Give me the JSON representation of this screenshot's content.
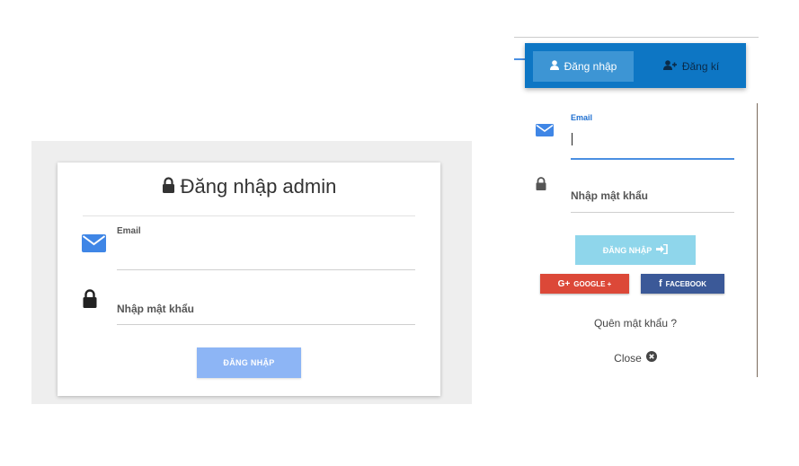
{
  "admin": {
    "title": "Đăng nhập admin",
    "email_label": "Email",
    "email_value": "",
    "password_placeholder": "Nhập mật khẩu",
    "submit_label": "ĐĂNG NHẬP"
  },
  "modal": {
    "tabs": [
      {
        "label": "Đăng nhập",
        "icon": "user-icon",
        "active": true
      },
      {
        "label": "Đăng kí",
        "icon": "user-plus-icon",
        "active": false
      }
    ],
    "email_label": "Email",
    "email_value": "",
    "password_placeholder": "Nhập mật khẩu",
    "submit_label": "ĐĂNG NHẬP",
    "google_label": "GOOGLE +",
    "facebook_label": "FACEBOOK",
    "forgot_label": "Quên mật khẩu ?",
    "close_label": "Close"
  },
  "colors": {
    "admin_button": "#8db5f5",
    "tab_bar": "#0d76c4",
    "modal_button": "#8fd6eb",
    "google": "#dc4838",
    "facebook": "#3b5998",
    "accent_blue": "#4a8fe2"
  }
}
